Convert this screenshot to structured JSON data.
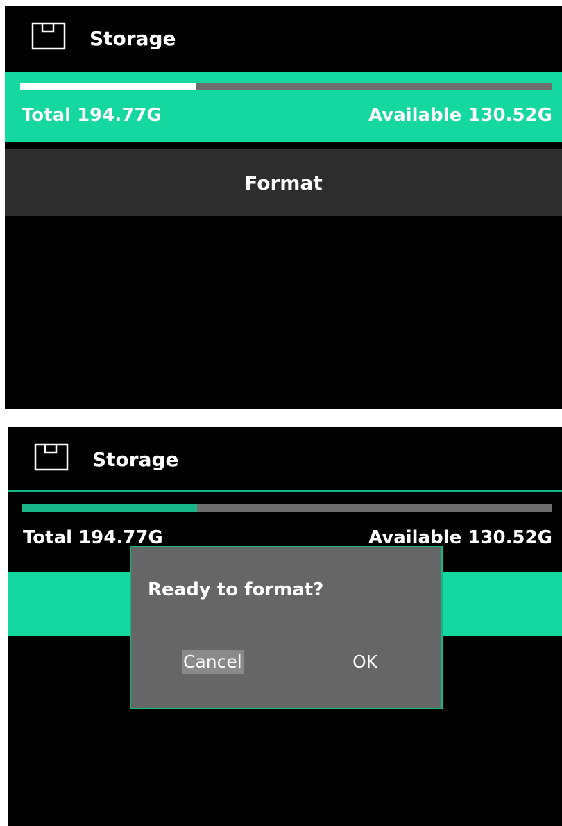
{
  "screens": [
    {
      "header": {
        "title": "Storage",
        "icon": "storage-card-icon"
      },
      "storage": {
        "total_label": "Total 194.77G",
        "available_label": "Available 130.52G",
        "used_fraction": 0.33
      },
      "format_button": {
        "label": "Format"
      }
    },
    {
      "header": {
        "title": "Storage",
        "icon": "storage-card-icon"
      },
      "storage": {
        "total_label": "Total 194.77G",
        "available_label": "Available 130.52G",
        "used_fraction": 0.33
      },
      "format_button": {
        "label": ""
      },
      "dialog": {
        "question": "Ready to format?",
        "cancel_label": "Cancel",
        "ok_label": "OK"
      }
    }
  ],
  "colors": {
    "accent": "#14d89f",
    "accent_dark": "#18b687",
    "dialog_bg": "#666666",
    "button_bg": "#2d2d2d"
  }
}
